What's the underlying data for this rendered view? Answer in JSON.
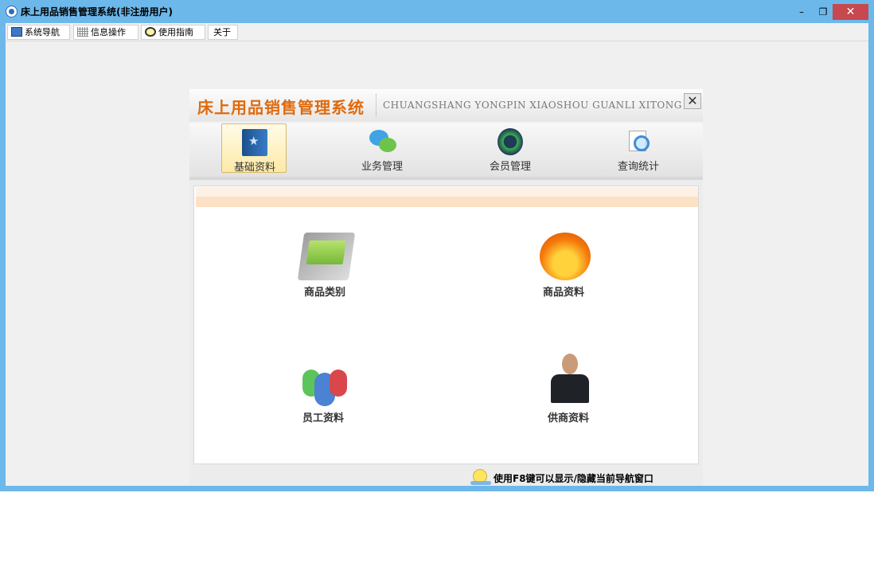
{
  "window": {
    "title": "床上用品销售管理系统(非注册用户)",
    "controls": {
      "minimize": "–",
      "restore": "❐",
      "close": "✕"
    }
  },
  "menubar": {
    "items": [
      {
        "label": "系统导航",
        "icon": "monitor-icon"
      },
      {
        "label": "信息操作",
        "icon": "grid-icon"
      },
      {
        "label": "使用指南",
        "icon": "clock-icon"
      },
      {
        "label": "关于",
        "icon": ""
      }
    ]
  },
  "nav_panel": {
    "title": "床上用品销售管理系统",
    "subtitle": "CHUANGSHANG YONGPIN XIAOSHOU GUANLI XITONG",
    "close": "✕",
    "tabs": [
      {
        "label": "基础资料",
        "icon": "book-star-icon",
        "active": true
      },
      {
        "label": "业务管理",
        "icon": "chat-bubbles-icon",
        "active": false
      },
      {
        "label": "会员管理",
        "icon": "member-cycle-icon",
        "active": false
      },
      {
        "label": "查询统计",
        "icon": "document-search-icon",
        "active": false
      }
    ],
    "tiles": [
      {
        "label": "商品类别",
        "icon": "category-card-icon"
      },
      {
        "label": "商品资料",
        "icon": "product-flame-icon"
      },
      {
        "label": "员工资料",
        "icon": "staff-group-icon"
      },
      {
        "label": "供商资料",
        "icon": "supplier-person-icon"
      }
    ],
    "footer_hint": "使用F8键可以显示/隐藏当前导航窗口"
  },
  "colors": {
    "titlebar": "#6db8ea",
    "close_button": "#c7484e",
    "header_title": "#e06a0c",
    "active_tab": "#fde9a6"
  }
}
